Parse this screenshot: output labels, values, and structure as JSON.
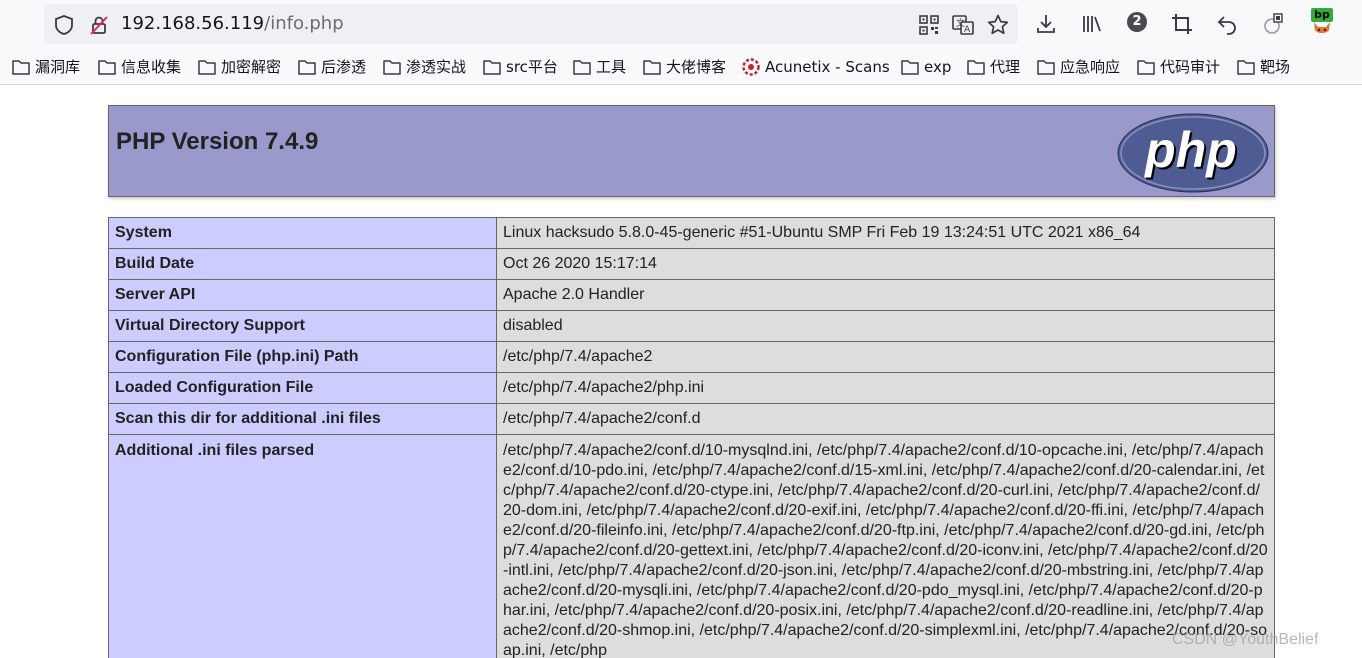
{
  "browser": {
    "url_host": "192.168.56.119",
    "url_path": "/info.php",
    "extension_badge": "2",
    "bp_label": "bp"
  },
  "bookmarks": [
    {
      "label": "漏洞库",
      "icon": "folder-icon"
    },
    {
      "label": "信息收集",
      "icon": "folder-icon"
    },
    {
      "label": "加密解密",
      "icon": "folder-icon"
    },
    {
      "label": "后渗透",
      "icon": "folder-icon"
    },
    {
      "label": "渗透实战",
      "icon": "folder-icon"
    },
    {
      "label": "src平台",
      "icon": "folder-icon"
    },
    {
      "label": "工具",
      "icon": "folder-icon"
    },
    {
      "label": "大佬博客",
      "icon": "folder-icon"
    },
    {
      "label": "Acunetix - Scans",
      "icon": "acunetix-icon"
    },
    {
      "label": "exp",
      "icon": "folder-icon"
    },
    {
      "label": "代理",
      "icon": "folder-icon"
    },
    {
      "label": "应急响应",
      "icon": "folder-icon"
    },
    {
      "label": "代码审计",
      "icon": "folder-icon"
    },
    {
      "label": "靶场",
      "icon": "folder-icon"
    }
  ],
  "phpinfo": {
    "title": "PHP Version 7.4.9",
    "logo_text": "php",
    "rows": [
      {
        "key": "System",
        "value": "Linux hacksudo 5.8.0-45-generic #51-Ubuntu SMP Fri Feb 19 13:24:51 UTC 2021 x86_64"
      },
      {
        "key": "Build Date",
        "value": "Oct 26 2020 15:17:14"
      },
      {
        "key": "Server API",
        "value": "Apache 2.0 Handler"
      },
      {
        "key": "Virtual Directory Support",
        "value": "disabled"
      },
      {
        "key": "Configuration File (php.ini) Path",
        "value": "/etc/php/7.4/apache2"
      },
      {
        "key": "Loaded Configuration File",
        "value": "/etc/php/7.4/apache2/php.ini"
      },
      {
        "key": "Scan this dir for additional .ini files",
        "value": "/etc/php/7.4/apache2/conf.d"
      },
      {
        "key": "Additional .ini files parsed",
        "value": "/etc/php/7.4/apache2/conf.d/10-mysqlnd.ini, /etc/php/7.4/apache2/conf.d/10-opcache.ini, /etc/php/7.4/apache2/conf.d/10-pdo.ini, /etc/php/7.4/apache2/conf.d/15-xml.ini, /etc/php/7.4/apache2/conf.d/20-calendar.ini, /etc/php/7.4/apache2/conf.d/20-ctype.ini, /etc/php/7.4/apache2/conf.d/20-curl.ini, /etc/php/7.4/apache2/conf.d/20-dom.ini, /etc/php/7.4/apache2/conf.d/20-exif.ini, /etc/php/7.4/apache2/conf.d/20-ffi.ini, /etc/php/7.4/apache2/conf.d/20-fileinfo.ini, /etc/php/7.4/apache2/conf.d/20-ftp.ini, /etc/php/7.4/apache2/conf.d/20-gd.ini, /etc/php/7.4/apache2/conf.d/20-gettext.ini, /etc/php/7.4/apache2/conf.d/20-iconv.ini, /etc/php/7.4/apache2/conf.d/20-intl.ini, /etc/php/7.4/apache2/conf.d/20-json.ini, /etc/php/7.4/apache2/conf.d/20-mbstring.ini, /etc/php/7.4/apache2/conf.d/20-mysqli.ini, /etc/php/7.4/apache2/conf.d/20-pdo_mysql.ini, /etc/php/7.4/apache2/conf.d/20-phar.ini, /etc/php/7.4/apache2/conf.d/20-posix.ini, /etc/php/7.4/apache2/conf.d/20-readline.ini, /etc/php/7.4/apache2/conf.d/20-shmop.ini, /etc/php/7.4/apache2/conf.d/20-simplexml.ini, /etc/php/7.4/apache2/conf.d/20-soap.ini, /etc/php"
      }
    ]
  },
  "watermark": "CSDN @YouthBelief"
}
